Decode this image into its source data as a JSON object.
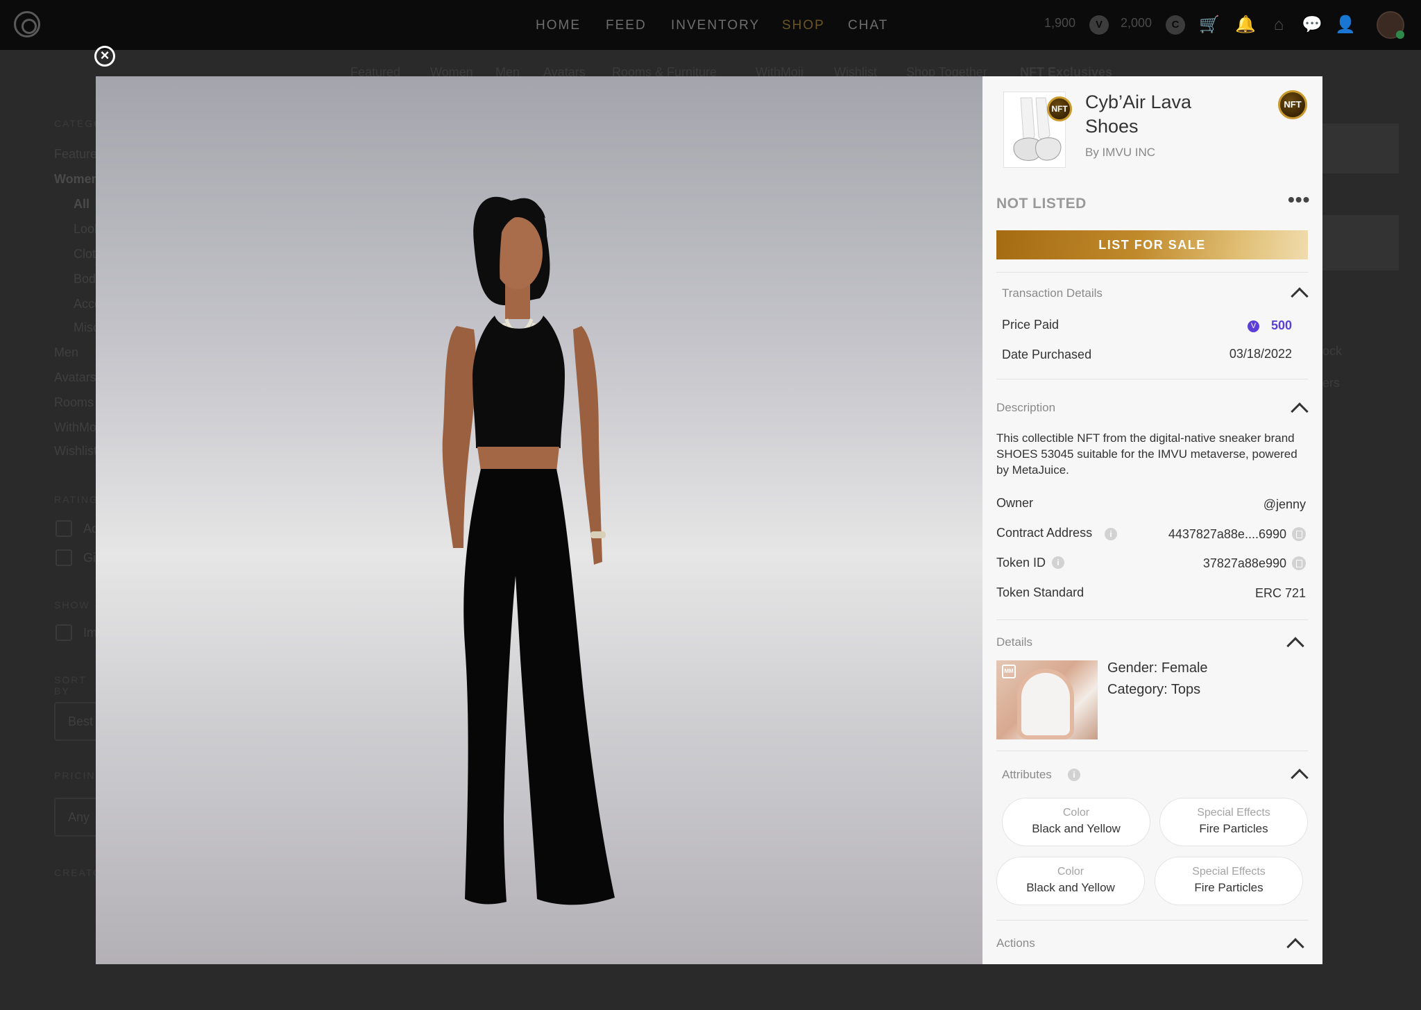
{
  "topbar": {
    "nav": [
      "HOME",
      "FEED",
      "INVENTORY",
      "SHOP",
      "CHAT"
    ],
    "active_nav": "SHOP",
    "credits_a": "1,900",
    "credits_b": "2,000",
    "icons": [
      "vcoin-icon",
      "credit-icon",
      "cart-icon",
      "bell-icon",
      "home-icon",
      "chat-icon",
      "friends-icon"
    ]
  },
  "subnav": [
    "Featured",
    "Women",
    "Men",
    "Avatars",
    "Rooms & Furniture",
    "WithMoji",
    "Wishlist",
    "Shop Together",
    "NFT Exclusives"
  ],
  "left_panel": {
    "category_heading": "CATEGORY",
    "items": [
      "Featured",
      "Women",
      "All",
      "Looks",
      "Clothing",
      "Body",
      "Accessories",
      "Misc",
      "Men",
      "Avatars",
      "Rooms",
      "WithMoji",
      "Wishlist"
    ],
    "rating_heading": "RATING",
    "rating_options": [
      "Ad",
      "Gi"
    ],
    "show_heading": "SHOW",
    "show_options": [
      "Im"
    ],
    "sort_heading": "SORT BY",
    "sort_value": "Best",
    "pricing_heading": "PRICING",
    "pricing_value": "Any",
    "creator_heading": "CREATOR"
  },
  "right_bg": {
    "frag1": "ock",
    "frag2": "ers"
  },
  "modal": {
    "product": {
      "title": "Cyb’Air Lava Shoes",
      "byline": "By IMVU INC",
      "nft_label": "NFT",
      "status": "NOT LISTED",
      "more_label": "•••",
      "list_button": "LIST FOR SALE"
    },
    "transaction": {
      "heading": "Transaction Details",
      "price_label": "Price Paid",
      "price_value": "500",
      "date_label": "Date Purchased",
      "date_value": "03/18/2022"
    },
    "description": {
      "heading": "Description",
      "text": "This collectible NFT from the digital-native sneaker brand SHOES 53045 suitable for the IMVU metaverse, powered by MetaJuice.",
      "owner_label": "Owner",
      "owner_value": "@jenny",
      "contract_label": "Contract Address",
      "contract_value": "4437827a88e....6990",
      "token_label": "Token ID",
      "token_value": "37827a88e990",
      "standard_label": "Token Standard",
      "standard_value": "ERC 721"
    },
    "details": {
      "heading": "Details",
      "gender": "Gender: Female",
      "category": "Category: Tops",
      "badge": "MM"
    },
    "attributes": {
      "heading": "Attributes",
      "items": [
        {
          "key": "Color",
          "value": "Black and Yellow"
        },
        {
          "key": "Special Effects",
          "value": "Fire Particles"
        },
        {
          "key": "Color",
          "value": "Black and Yellow"
        },
        {
          "key": "Special Effects",
          "value": "Fire Particles"
        }
      ]
    },
    "actions": {
      "heading": "Actions"
    }
  },
  "colors": {
    "accent_gold": "#c0892a",
    "price_purple": "#5b3fd6",
    "panel_bg": "#f7f7f7"
  }
}
